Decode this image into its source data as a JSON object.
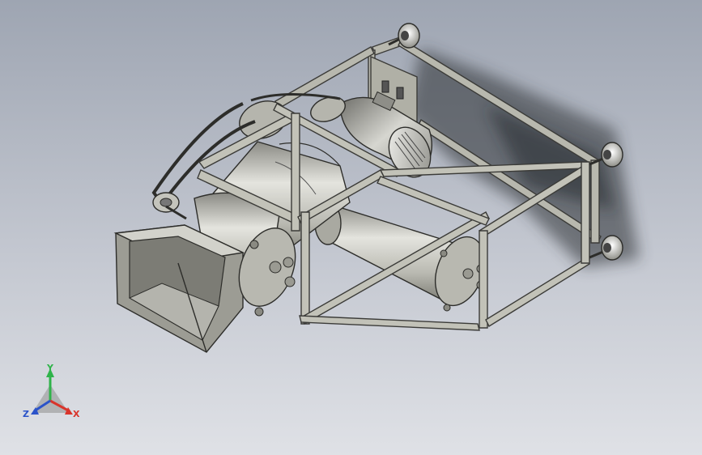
{
  "viewport": {
    "background_top": "#9ea5b2",
    "background_bottom": "#dfe1e6"
  },
  "model": {
    "frame_color": "#b8b8ae",
    "part_color": "#bcbcb4",
    "shadow_color": "#2a2d33"
  },
  "triad": {
    "y_label": "Y",
    "x_label": "X",
    "z_label": "Z",
    "y_color": "#2fb34a",
    "x_color": "#d9342b",
    "z_color": "#2b53c9"
  }
}
